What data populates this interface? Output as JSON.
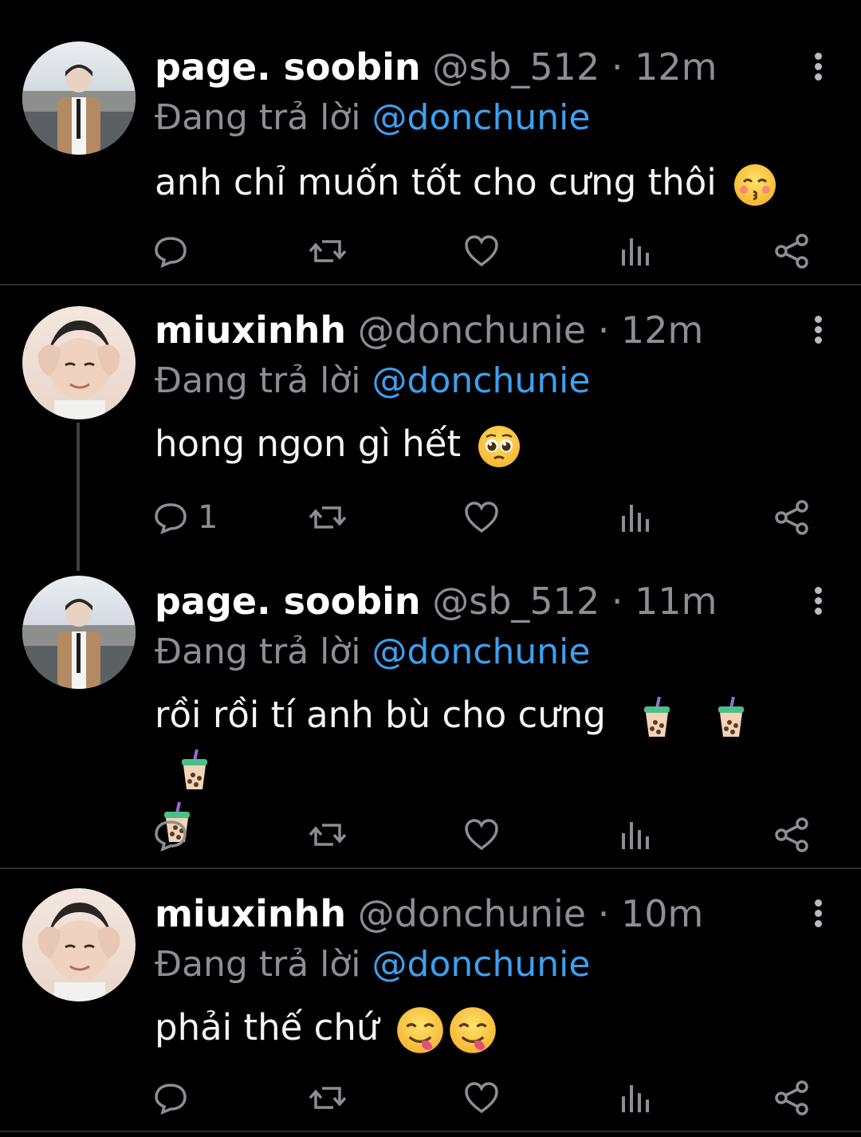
{
  "tweets": [
    {
      "name": "page. soobin",
      "handle": "@sb_512",
      "time": "· 12m",
      "reply_prefix": "Đang trả lời ",
      "reply_to": "@donchunie",
      "text": "anh chỉ muốn tốt cho cưng thôi",
      "emojis": [
        "kissing-face-emoji"
      ],
      "reply_count": ""
    },
    {
      "name": "miuxinhh",
      "handle": "@donchunie",
      "time": "· 12m",
      "reply_prefix": "Đang trả lời ",
      "reply_to": "@donchunie",
      "text": "hong ngon gì hết",
      "emojis": [
        "pleading-face-emoji"
      ],
      "reply_count": "1"
    },
    {
      "name": "page. soobin",
      "handle": "@sb_512",
      "time": "· 11m",
      "reply_prefix": "Đang trả lời ",
      "reply_to": "@donchunie",
      "text": "rồi rồi tí anh bù cho cưng",
      "emojis": [
        "bubble-tea-emoji",
        "bubble-tea-emoji",
        "bubble-tea-emoji",
        "bubble-tea-emoji"
      ],
      "reply_count": ""
    },
    {
      "name": "miuxinhh",
      "handle": "@donchunie",
      "time": "· 10m",
      "reply_prefix": "Đang trả lời ",
      "reply_to": "@donchunie",
      "text": "phải thế chứ",
      "emojis": [
        "yummy-face-emoji",
        "yummy-face-emoji"
      ],
      "reply_count": ""
    }
  ],
  "icons": {
    "reply": "reply-icon",
    "retweet": "retweet-icon",
    "like": "heart-icon",
    "views": "views-icon",
    "share": "share-icon",
    "more": "more-vertical-icon"
  },
  "colors": {
    "background": "#000000",
    "mention": "#3ea0ef",
    "secondary_text": "#8b8f94",
    "divider": "#2b2e32"
  }
}
